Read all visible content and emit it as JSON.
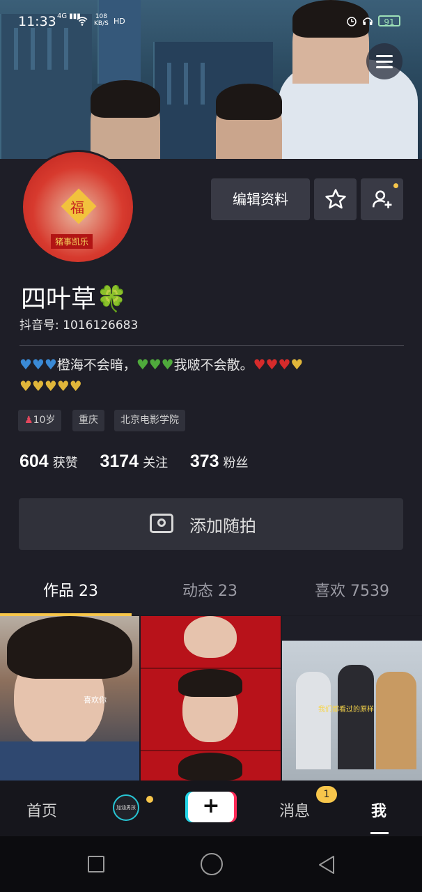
{
  "status_bar": {
    "time": "11:33",
    "network": "4G",
    "speed_value": "108",
    "speed_unit": "KB/S",
    "hd": "HD",
    "battery": "91"
  },
  "profile": {
    "nickname": "四叶草🍀",
    "douyin_id": "抖音号: 1016126683",
    "avatar_caption": "猪事凯乐",
    "avatar_center_char": "福",
    "edit_button": "编辑资料",
    "bio_line1_text_a": "橙海不会暗，",
    "bio_line1_text_b": "我啵不会散。",
    "tags": [
      "10岁",
      "重庆",
      "北京电影学院"
    ],
    "stats": [
      {
        "value": "604",
        "label": "获赞"
      },
      {
        "value": "3174",
        "label": "关注"
      },
      {
        "value": "373",
        "label": "粉丝"
      }
    ],
    "add_snap_label": "添加随拍"
  },
  "tabs": [
    {
      "label": "作品 23",
      "active": true
    },
    {
      "label": "动态 23",
      "active": false
    },
    {
      "label": "喜欢 7539",
      "active": false
    }
  ],
  "grid_captions": {
    "g1": "喜欢你",
    "g3": "我们都看过的原样"
  },
  "bottom_nav": {
    "home": "首页",
    "live_circle": "加油男孩",
    "plus": "+",
    "messages": "消息",
    "messages_badge": "1",
    "me": "我"
  },
  "colors": {
    "accent_yellow": "#f7c64b",
    "background": "#1e1e27",
    "button_bg": "#393a45"
  }
}
